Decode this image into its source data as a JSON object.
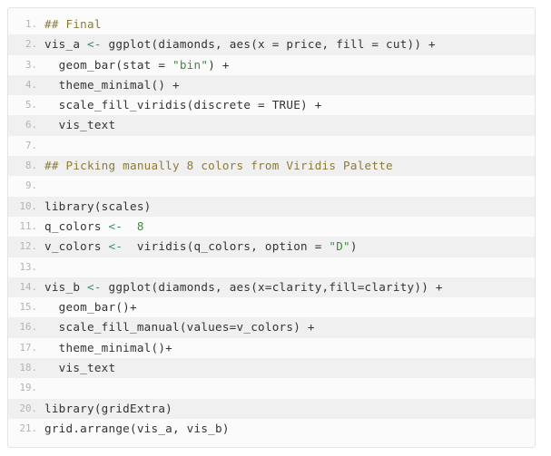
{
  "editor": {
    "language": "r",
    "background_color": "#fbfbfb",
    "border_color": "#e4e4e4",
    "text_color": "#333333",
    "gutter_color": "#b3b3b3",
    "stripe_color": "#f0f0f0",
    "comment_color": "#8a7b3b",
    "string_color": "#3f8a3f",
    "number_color": "#3f8a3f",
    "assign_color": "#3f8a6a",
    "total_lines": 21
  },
  "lines": [
    {
      "number": "1.",
      "striped": false,
      "tokens": [
        {
          "text": "## Final",
          "type": "comment"
        }
      ]
    },
    {
      "number": "2.",
      "striped": true,
      "tokens": [
        {
          "text": "vis_a ",
          "type": "plain"
        },
        {
          "text": "<-",
          "type": "assign"
        },
        {
          "text": " ggplot(diamonds, aes(x = price, fill = cut)) +",
          "type": "plain"
        }
      ]
    },
    {
      "number": "3.",
      "striped": false,
      "tokens": [
        {
          "text": "  geom_bar(stat = ",
          "type": "plain"
        },
        {
          "text": "\"bin\"",
          "type": "string"
        },
        {
          "text": ") +",
          "type": "plain"
        }
      ]
    },
    {
      "number": "4.",
      "striped": true,
      "tokens": [
        {
          "text": "  theme_minimal() +",
          "type": "plain"
        }
      ]
    },
    {
      "number": "5.",
      "striped": false,
      "tokens": [
        {
          "text": "  scale_fill_viridis(discrete = ",
          "type": "plain"
        },
        {
          "text": "TRUE",
          "type": "const"
        },
        {
          "text": ") +",
          "type": "plain"
        }
      ]
    },
    {
      "number": "6.",
      "striped": true,
      "tokens": [
        {
          "text": "  vis_text",
          "type": "plain"
        }
      ]
    },
    {
      "number": "7.",
      "striped": false,
      "tokens": [
        {
          "text": "",
          "type": "plain"
        }
      ]
    },
    {
      "number": "8.",
      "striped": true,
      "tokens": [
        {
          "text": "## Picking manually 8 colors from Viridis Palette",
          "type": "comment"
        }
      ]
    },
    {
      "number": "9.",
      "striped": false,
      "tokens": [
        {
          "text": "",
          "type": "plain"
        }
      ]
    },
    {
      "number": "10.",
      "striped": true,
      "tokens": [
        {
          "text": "library(scales)",
          "type": "plain"
        }
      ]
    },
    {
      "number": "11.",
      "striped": false,
      "tokens": [
        {
          "text": "q_colors ",
          "type": "plain"
        },
        {
          "text": "<-",
          "type": "assign"
        },
        {
          "text": "  ",
          "type": "plain"
        },
        {
          "text": "8",
          "type": "number"
        }
      ]
    },
    {
      "number": "12.",
      "striped": true,
      "tokens": [
        {
          "text": "v_colors ",
          "type": "plain"
        },
        {
          "text": "<-",
          "type": "assign"
        },
        {
          "text": "  viridis(q_colors, option = ",
          "type": "plain"
        },
        {
          "text": "\"D\"",
          "type": "string"
        },
        {
          "text": ")",
          "type": "plain"
        }
      ]
    },
    {
      "number": "13.",
      "striped": false,
      "tokens": [
        {
          "text": "",
          "type": "plain"
        }
      ]
    },
    {
      "number": "14.",
      "striped": true,
      "tokens": [
        {
          "text": "vis_b ",
          "type": "plain"
        },
        {
          "text": "<-",
          "type": "assign"
        },
        {
          "text": " ggplot(diamonds, aes(x=clarity,fill=clarity)) +",
          "type": "plain"
        }
      ]
    },
    {
      "number": "15.",
      "striped": false,
      "tokens": [
        {
          "text": "  geom_bar()+",
          "type": "plain"
        }
      ]
    },
    {
      "number": "16.",
      "striped": true,
      "tokens": [
        {
          "text": "  scale_fill_manual(values=v_colors) +",
          "type": "plain"
        }
      ]
    },
    {
      "number": "17.",
      "striped": false,
      "tokens": [
        {
          "text": "  theme_minimal()+",
          "type": "plain"
        }
      ]
    },
    {
      "number": "18.",
      "striped": true,
      "tokens": [
        {
          "text": "  vis_text",
          "type": "plain"
        }
      ]
    },
    {
      "number": "19.",
      "striped": false,
      "tokens": [
        {
          "text": "",
          "type": "plain"
        }
      ]
    },
    {
      "number": "20.",
      "striped": true,
      "tokens": [
        {
          "text": "library(gridExtra)",
          "type": "plain"
        }
      ]
    },
    {
      "number": "21.",
      "striped": false,
      "tokens": [
        {
          "text": "grid.arrange(vis_a, vis_b)",
          "type": "plain"
        }
      ]
    }
  ]
}
